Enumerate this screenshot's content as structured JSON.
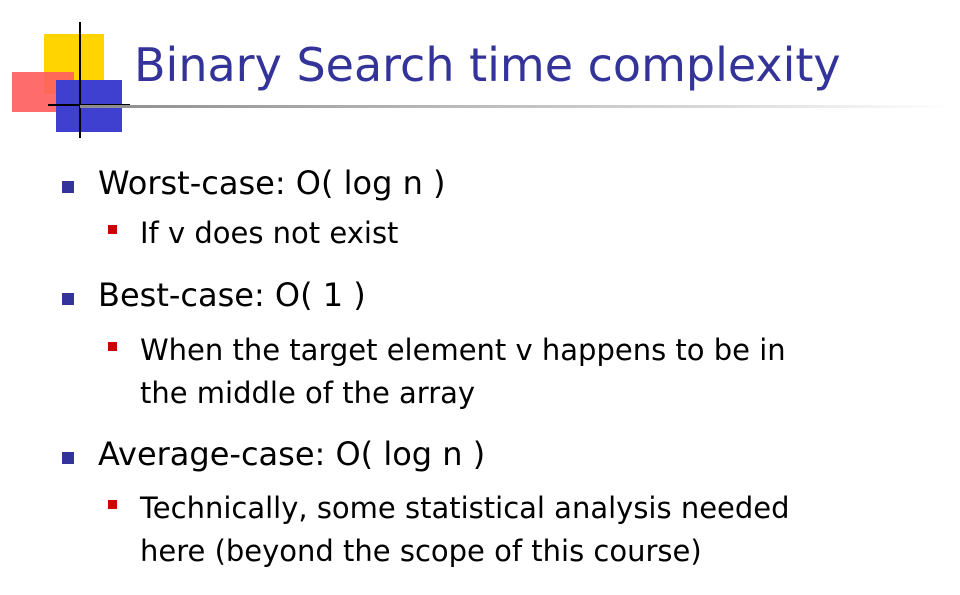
{
  "slide": {
    "title": "Binary Search time complexity",
    "bullets": [
      {
        "text": "Worst-case:  O( log n )",
        "sub": [
          "If v does not exist"
        ]
      },
      {
        "text": "Best-case:  O( 1 )",
        "sub": [
          "When the target element v happens to be in",
          "the middle of the array"
        ]
      },
      {
        "text": "Average-case:  O( log n )",
        "sub": [
          "Technically, some statistical analysis needed",
          "here (beyond the scope of this course)"
        ]
      }
    ]
  },
  "colors": {
    "title": "#333399",
    "bullet_main": "#333399",
    "bullet_sub": "#cc0000",
    "logo_yellow": "#ffd400",
    "logo_red": "#ff5f5f",
    "logo_blue": "#4040d0"
  }
}
